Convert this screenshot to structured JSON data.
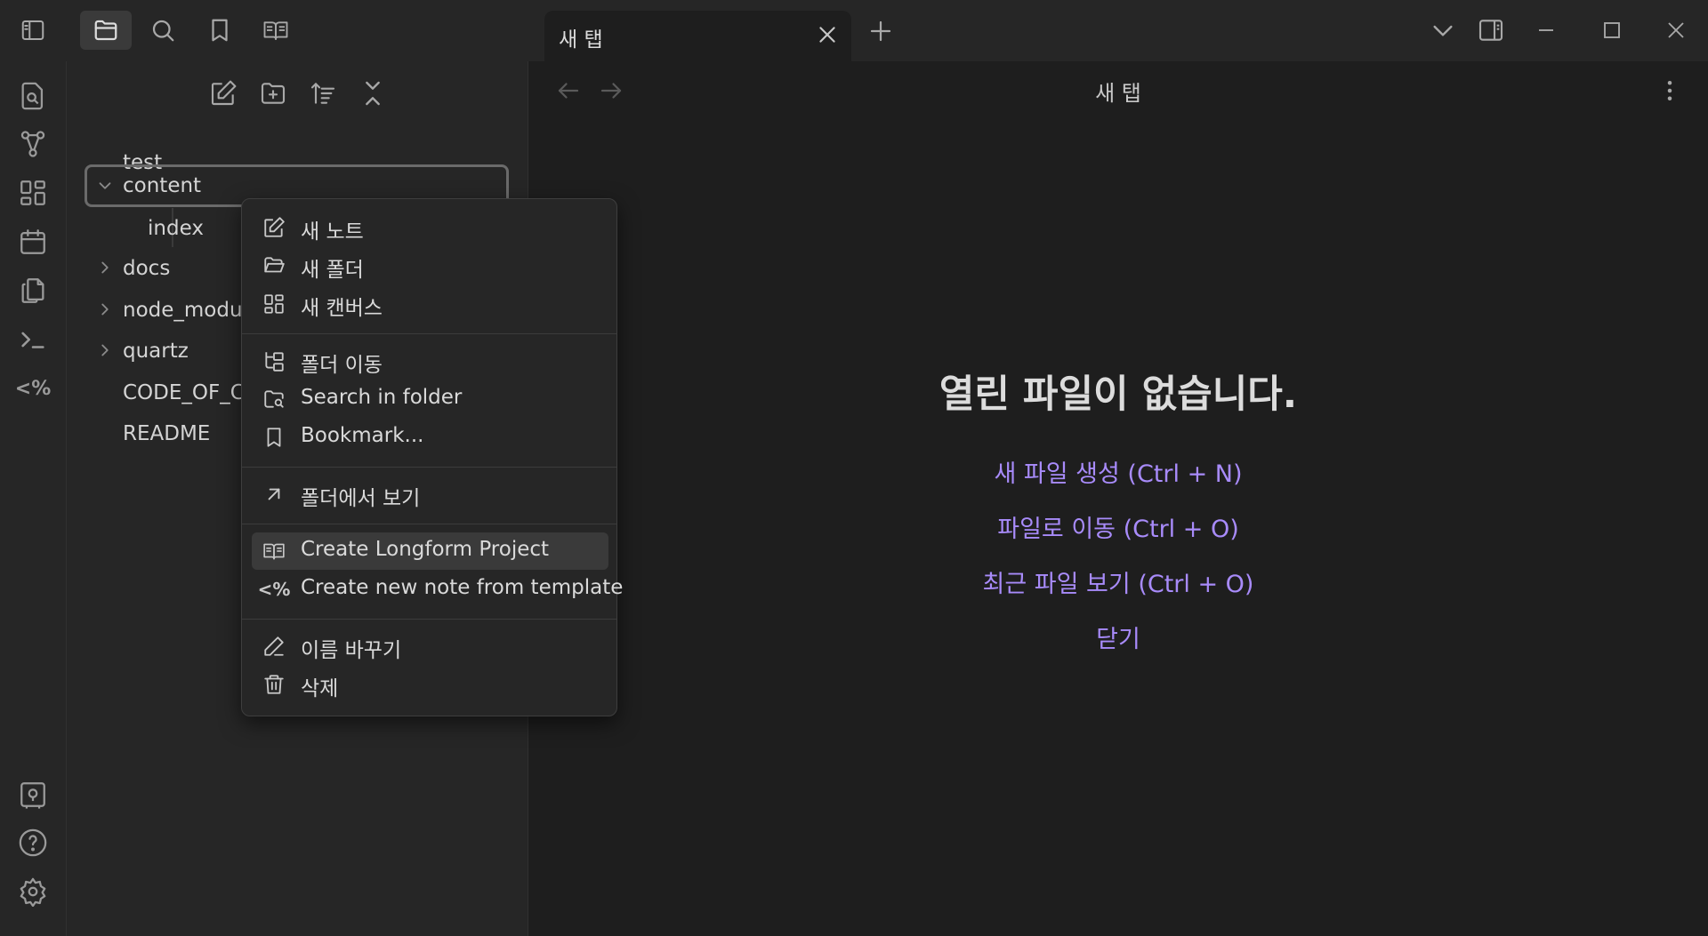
{
  "titlebar": {
    "tab_title": "새 탭"
  },
  "explorer": {
    "items": [
      {
        "label": "test"
      },
      {
        "label": "content"
      },
      {
        "label": "index"
      },
      {
        "label": "docs"
      },
      {
        "label": "node_modules"
      },
      {
        "label": "quartz"
      },
      {
        "label": "CODE_OF_CONDUCT"
      },
      {
        "label": "README"
      }
    ]
  },
  "main": {
    "header_title": "새 탭",
    "empty_title": "열린 파일이 없습니다.",
    "links": [
      {
        "label": "새 파일 생성 (Ctrl + N)"
      },
      {
        "label": "파일로 이동 (Ctrl + O)"
      },
      {
        "label": "최근 파일 보기 (Ctrl + O)"
      },
      {
        "label": "닫기"
      }
    ]
  },
  "context_menu": {
    "items": [
      {
        "label": "새 노트",
        "icon": "edit-icon"
      },
      {
        "label": "새 폴더",
        "icon": "folder-open-icon"
      },
      {
        "label": "새 캔버스",
        "icon": "canvas-icon"
      },
      {
        "label": "폴더 이동",
        "icon": "folder-tree-icon"
      },
      {
        "label": "Search in folder",
        "icon": "folder-search-icon"
      },
      {
        "label": "Bookmark...",
        "icon": "bookmark-icon"
      },
      {
        "label": "폴더에서 보기",
        "icon": "arrow-up-right-icon"
      },
      {
        "label": "Create Longform Project",
        "icon": "book-icon"
      },
      {
        "label": "Create new note from template",
        "icon": "template-icon"
      },
      {
        "label": "이름 바꾸기",
        "icon": "pencil-icon"
      },
      {
        "label": "삭제",
        "icon": "trash-icon"
      }
    ],
    "template_icon_glyph": "<%"
  },
  "ribbon": {
    "template_glyph": "<%"
  },
  "colors": {
    "accent": "#a88bfa",
    "background": "#1e1e1e",
    "panel": "#262626"
  }
}
